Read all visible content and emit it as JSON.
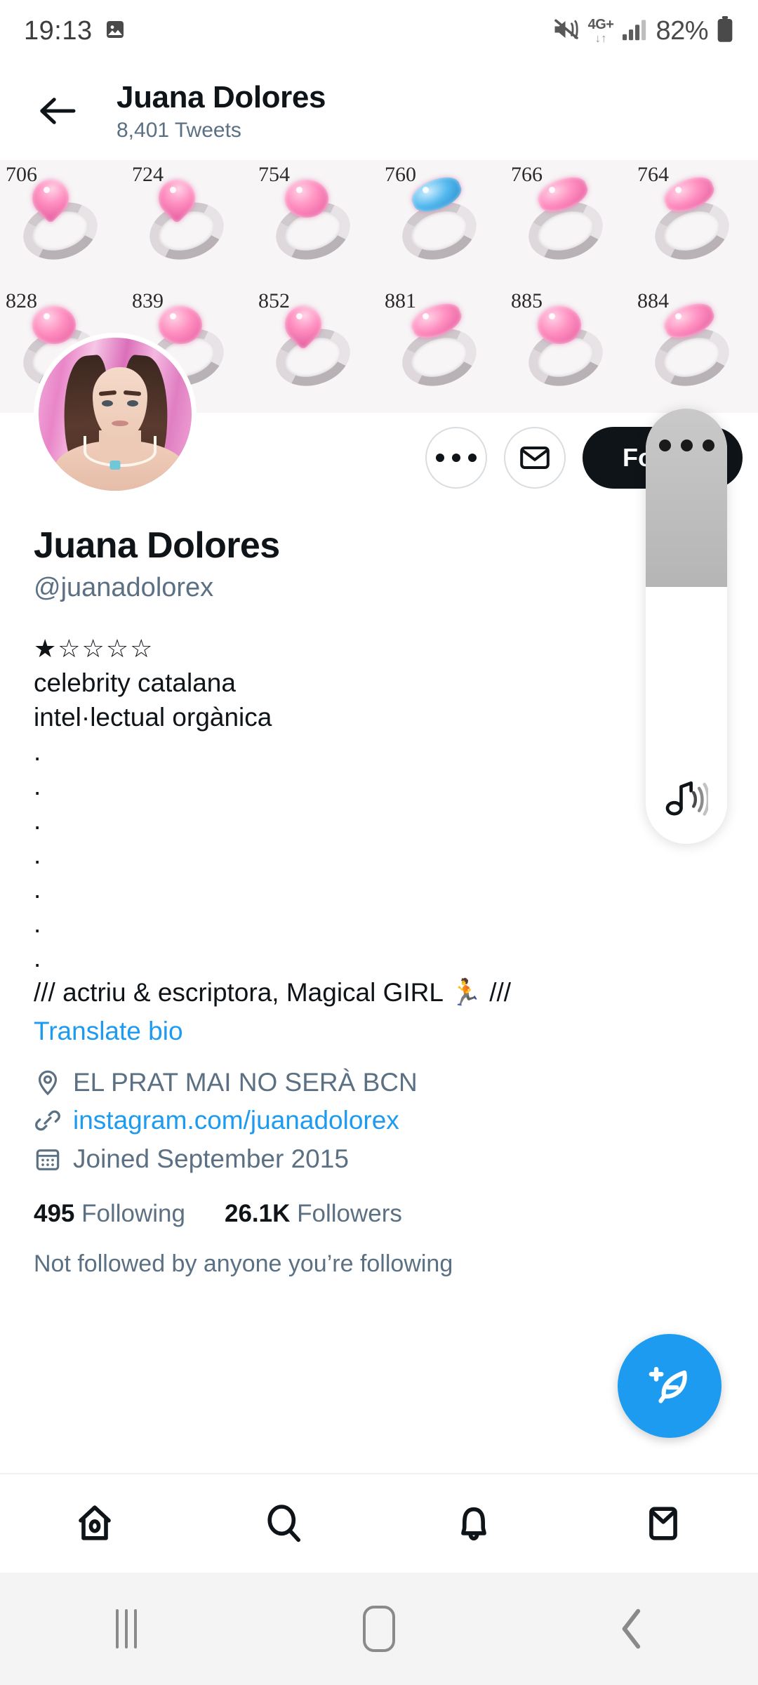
{
  "statusbar": {
    "clock": "19:13",
    "gallery_icon": "image-icon",
    "mute_icon": "mute-icon",
    "network_label": "4G+",
    "network_arrows": "↓↑",
    "signal_icon": "signal-bars-icon",
    "battery_percent": "82%",
    "battery_icon": "battery-icon"
  },
  "appbar": {
    "back_icon": "back-arrow-icon",
    "name": "Juana Dolores",
    "tweet_count": "8,401 Tweets"
  },
  "banner": {
    "alt": "catalog of pink gemstone rings",
    "rings": [
      {
        "number": "706",
        "gem": "heart",
        "color": "pink"
      },
      {
        "number": "724",
        "gem": "heart",
        "color": "pink"
      },
      {
        "number": "754",
        "gem": "round",
        "color": "pink"
      },
      {
        "number": "760",
        "gem": "marq",
        "color": "blue"
      },
      {
        "number": "766",
        "gem": "marq",
        "color": "pink"
      },
      {
        "number": "764",
        "gem": "marq",
        "color": "pink"
      },
      {
        "number": "828",
        "gem": "round",
        "color": "pink"
      },
      {
        "number": "839",
        "gem": "round",
        "color": "pink"
      },
      {
        "number": "852",
        "gem": "heart",
        "color": "pink"
      },
      {
        "number": "881",
        "gem": "marq",
        "color": "pink"
      },
      {
        "number": "885",
        "gem": "round",
        "color": "pink"
      },
      {
        "number": "884",
        "gem": "marq",
        "color": "pink"
      }
    ]
  },
  "actions": {
    "more_icon": "more-options-icon",
    "message_icon": "envelope-icon",
    "follow_label": "Follow"
  },
  "profile": {
    "avatar": "profile-avatar",
    "display_name": "Juana Dolores",
    "handle": "@juanadolorex",
    "bio_lines": [
      "★☆☆☆☆",
      "celebrity catalana",
      "intel·lectual orgànica",
      ".",
      ".",
      ".",
      ".",
      ".",
      ".",
      ".",
      "/// actriu & escriptora, Magical GIRL 🏃 ///"
    ],
    "translate_label": "Translate bio",
    "location_icon": "location-pin-icon",
    "location": "EL PRAT MAI NO SERÀ BCN",
    "link_icon": "link-icon",
    "link": "instagram.com/juanadolorex",
    "calendar_icon": "calendar-icon",
    "joined": "Joined September 2015",
    "following_count": "495",
    "following_label": "Following",
    "followers_count": "26.1K",
    "followers_label": "Followers",
    "not_followed_note": "Not followed by anyone you’re following"
  },
  "fab": {
    "icon": "compose-feather-icon",
    "label": "Compose Tweet"
  },
  "bottomnav": {
    "items": [
      {
        "icon": "home-icon",
        "label": "Home"
      },
      {
        "icon": "search-icon",
        "label": "Search"
      },
      {
        "icon": "bell-icon",
        "label": "Notifications"
      },
      {
        "icon": "envelope-icon",
        "label": "Messages"
      }
    ]
  },
  "volume_overlay": {
    "handle_icon": "drag-handle-dots-icon",
    "sound_icon": "music-note-waves-icon",
    "level_percent": 41
  },
  "sysnav": {
    "recents_icon": "recents-icon",
    "home_icon": "home-pill-icon",
    "back_icon": "back-chevron-icon"
  },
  "colors": {
    "accent": "#1d9bf0",
    "text": "#0f1419",
    "muted": "#5b7083",
    "follow_bg": "#0f1419"
  }
}
